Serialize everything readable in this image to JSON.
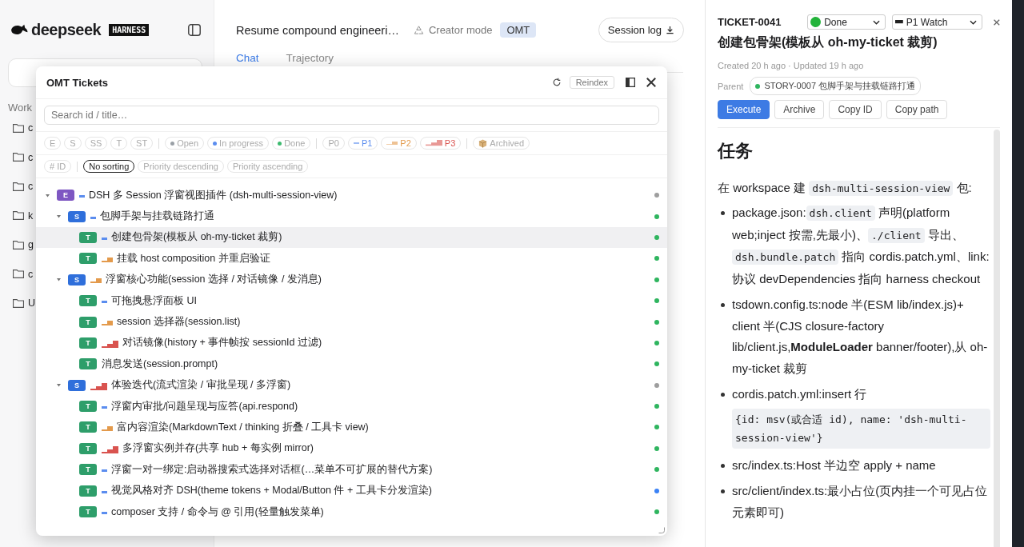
{
  "sidebar": {
    "brand": "deepseek",
    "edition": "HARNESS",
    "section": "Work",
    "folders": [
      "c",
      "c",
      "c",
      "k",
      "g",
      "c",
      "U"
    ]
  },
  "header": {
    "title": "Resume compound engineeri…",
    "mode": "Creator mode",
    "badge": "OMT",
    "session_button": "Session log",
    "tabs": [
      {
        "label": "Chat",
        "selected": true
      },
      {
        "label": "Trajectory",
        "selected": false
      }
    ]
  },
  "tickets_panel": {
    "title": "OMT Tickets",
    "reindex": "Reindex",
    "search": {
      "placeholder": "Search id / title…"
    },
    "filters": [
      {
        "label": "E",
        "kind": "type"
      },
      {
        "label": "S",
        "kind": "type"
      },
      {
        "label": "SS",
        "kind": "type"
      },
      {
        "label": "T",
        "kind": "type"
      },
      {
        "label": "ST",
        "kind": "type"
      },
      {
        "label": "Open",
        "kind": "status",
        "color": "#9aa0a6"
      },
      {
        "label": "In progress",
        "kind": "status",
        "color": "#5b8def"
      },
      {
        "label": "Done",
        "kind": "status",
        "color": "#3dba6f"
      },
      {
        "label": "P0",
        "kind": "p0"
      },
      {
        "label": "P1",
        "kind": "p1"
      },
      {
        "label": "P2",
        "kind": "p2"
      },
      {
        "label": "P3",
        "kind": "p3"
      },
      {
        "label": "Archived",
        "kind": "archive"
      }
    ],
    "sorts": [
      {
        "label": "# ID",
        "selected": false
      },
      {
        "label": "No sorting",
        "selected": true
      },
      {
        "label": "Priority descending",
        "selected": false
      },
      {
        "label": "Priority ascending",
        "selected": false
      }
    ],
    "tickets": [
      {
        "type": "E",
        "kind": "p1",
        "title": "DSH 多 Session 浮窗视图插件 (dsh-multi-session-view)",
        "color": "#9e9e9e",
        "expanded": true,
        "selected": false,
        "children": [
          {
            "type": "S",
            "kind": "p1",
            "title": "包脚手架与挂载链路打通",
            "color": "#2fb55f",
            "expanded": true,
            "selected": false,
            "children": [
              {
                "type": "T",
                "kind": "p1",
                "title": "创建包骨架(模板从 oh-my-ticket 裁剪)",
                "color": "#2fb55f",
                "selected": true
              },
              {
                "type": "T",
                "kind": "p2",
                "title": "挂载 host composition 并重启验证",
                "color": "#2fb55f",
                "selected": false
              }
            ]
          },
          {
            "type": "S",
            "kind": "p2",
            "title": "浮窗核心功能(session 选择 / 对话镜像 / 发消息)",
            "color": "#2fb55f",
            "expanded": true,
            "selected": false,
            "children": [
              {
                "type": "T",
                "kind": "p1",
                "title": "可拖拽悬浮面板 UI",
                "color": "#2fb55f",
                "selected": false
              },
              {
                "type": "T",
                "kind": "p2",
                "title": "session 选择器(session.list)",
                "color": "#2fb55f",
                "selected": false
              },
              {
                "type": "T",
                "kind": "p3",
                "title": "对话镜像(history + 事件帧按 sessionId 过滤)",
                "color": "#2fb55f",
                "selected": false
              },
              {
                "type": "T",
                "kind": "none",
                "title": "消息发送(session.prompt)",
                "color": "#2fb55f",
                "selected": false
              }
            ]
          },
          {
            "type": "S",
            "kind": "p3",
            "title": "体验迭代(流式渲染 / 审批呈现 / 多浮窗)",
            "color": "#9e9e9e",
            "expanded": true,
            "selected": false,
            "children": [
              {
                "type": "T",
                "kind": "p1",
                "title": "浮窗内审批/问题呈现与应答(api.respond)",
                "color": "#2fb55f",
                "selected": false
              },
              {
                "type": "T",
                "kind": "p2",
                "title": "富内容渲染(MarkdownText / thinking 折叠 / 工具卡 view)",
                "color": "#2fb55f",
                "selected": false
              },
              {
                "type": "T",
                "kind": "p3",
                "title": "多浮窗实例并存(共享 hub + 每实例 mirror)",
                "color": "#2fb55f",
                "selected": false
              },
              {
                "type": "T",
                "kind": "p1",
                "title": "浮窗一对一绑定:启动器搜索式选择对话框(…菜单不可扩展的替代方案)",
                "color": "#2fb55f",
                "selected": false
              },
              {
                "type": "T",
                "kind": "p1",
                "title": "视觉风格对齐 DSH(theme tokens + Modal/Button 件 + 工具卡分发渲染)",
                "color": "#3b82f6",
                "selected": false
              },
              {
                "type": "T",
                "kind": "p1",
                "title": "composer 支持 / 命令与 @ 引用(轻量触发菜单)",
                "color": "#2fb55f",
                "selected": false
              }
            ]
          }
        ]
      }
    ]
  },
  "detail": {
    "id": "TICKET-0041",
    "status": {
      "label": "Done",
      "color": "#22b33a"
    },
    "priority_select": {
      "label": "P1 Watch",
      "kind": "p1"
    },
    "title": "创建包骨架(模板从 oh-my-ticket 裁剪)",
    "meta": "Created 20 h ago · Updated 19 h ago",
    "parent_label": "Parent",
    "parent": {
      "text": "STORY-0007 包脚手架与挂载链路打通",
      "color": "#2fb55f"
    },
    "actions": [
      {
        "label": "Execute",
        "primary": true
      },
      {
        "label": "Archive",
        "primary": false
      },
      {
        "label": "Copy ID",
        "primary": false
      },
      {
        "label": "Copy path",
        "primary": false
      }
    ],
    "heading": "任务",
    "intro": [
      {
        "kind": "text",
        "text": "在 workspace 建 "
      },
      {
        "kind": "code",
        "text": "dsh-multi-session-view"
      },
      {
        "kind": "text",
        "text": " 包:"
      }
    ],
    "bullets": [
      [
        {
          "kind": "text",
          "text": "package.json:"
        },
        {
          "kind": "code",
          "text": "dsh.client"
        },
        {
          "kind": "text",
          "text": " 声明(platform web;inject 按需,先最小)、"
        },
        {
          "kind": "code",
          "text": "./client"
        },
        {
          "kind": "text",
          "text": " 导出、"
        },
        {
          "kind": "code",
          "text": "dsh.bundle.patch"
        },
        {
          "kind": "text",
          "text": " 指向 cordis.patch.yml、link: 协议 devDependencies 指向 harness checkout"
        }
      ],
      [
        {
          "kind": "text",
          "text": "tsdown.config.ts:node 半(ESM lib/index.js)+ client 半(CJS closure-factory lib/client.js,"
        },
        {
          "kind": "bold",
          "text": "ModuleLoader"
        },
        {
          "kind": "text",
          "text": " banner/footer),从 oh-my-ticket 裁剪"
        }
      ],
      [
        {
          "kind": "text",
          "text": "cordis.patch.yml:insert 行"
        },
        {
          "kind": "codeblock",
          "text": "{id: msv(或合适 id), name: 'dsh-multi-session-view'}"
        }
      ],
      [
        {
          "kind": "text",
          "text": "src/index.ts:Host 半边空 apply + name"
        }
      ],
      [
        {
          "kind": "text",
          "text": "src/client/index.ts:最小占位(页内挂一个可见占位元素即可)"
        }
      ]
    ]
  }
}
